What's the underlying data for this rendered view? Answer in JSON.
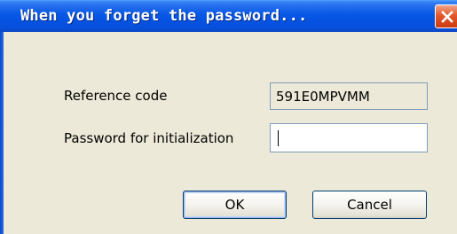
{
  "dialog": {
    "title": "When you forget the password...",
    "close_icon": "close-icon"
  },
  "fields": {
    "reference_label": "Reference code",
    "reference_value": "591E0MPVMM",
    "password_label": "Password for initialization",
    "password_value": ""
  },
  "buttons": {
    "ok_label": "OK",
    "cancel_label": "Cancel"
  },
  "colors": {
    "titlebar": "#0653e2",
    "close_button": "#e2582b",
    "dialog_background": "#ece9d8"
  }
}
